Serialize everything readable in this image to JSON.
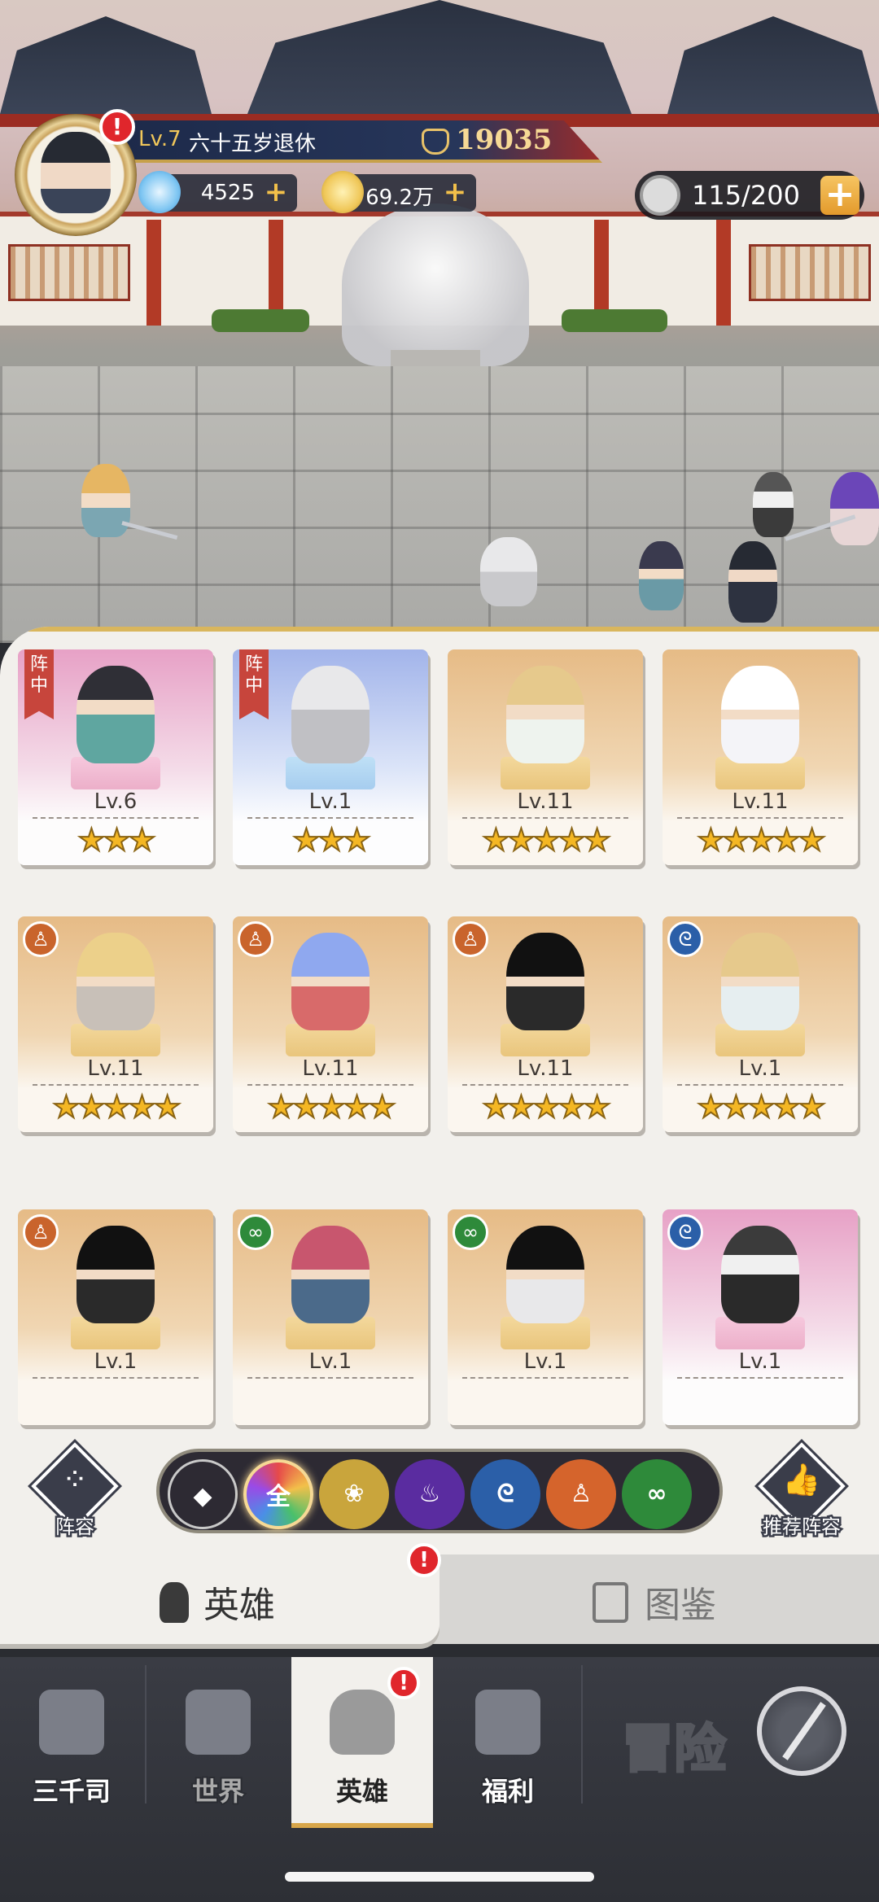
{
  "player": {
    "level_label": "Lv.7",
    "name": "六十五岁退休",
    "power": "19035",
    "alert": "!"
  },
  "resources": {
    "diamonds": "4525",
    "coins": "69.2万",
    "stamina": "115/200",
    "plus": "+"
  },
  "heroes": [
    {
      "level": "Lv.6",
      "stars": "★★★",
      "tag": "阵中",
      "bg": "pink"
    },
    {
      "level": "Lv.1",
      "stars": "★★★",
      "tag": "阵中",
      "bg": "blue"
    },
    {
      "level": "Lv.11",
      "stars": "★★★★★",
      "tag": "",
      "bg": "gold"
    },
    {
      "level": "Lv.11",
      "stars": "★★★★★",
      "tag": "",
      "bg": "gold"
    },
    {
      "level": "Lv.11",
      "stars": "★★★★★",
      "class_icon": "monk-icon",
      "bg": "gold"
    },
    {
      "level": "Lv.11",
      "stars": "★★★★★",
      "class_icon": "monk-icon",
      "bg": "gold"
    },
    {
      "level": "Lv.11",
      "stars": "★★★★★",
      "class_icon": "monk-icon",
      "bg": "gold"
    },
    {
      "level": "Lv.1",
      "stars": "★★★★★",
      "class_icon": "swirl-icon",
      "bg": "gold"
    },
    {
      "level": "Lv.1",
      "stars": "",
      "class_icon": "monk-icon",
      "bg": "gold"
    },
    {
      "level": "Lv.1",
      "stars": "",
      "class_icon": "dna-icon",
      "bg": "gold"
    },
    {
      "level": "Lv.1",
      "stars": "",
      "class_icon": "dna-icon",
      "bg": "gold"
    },
    {
      "level": "Lv.1",
      "stars": "",
      "class_icon": "swirl-icon",
      "bg": "pink"
    }
  ],
  "filters": {
    "all_label": "全",
    "lineup_label": "阵容",
    "recommend_label": "推荐阵容",
    "icons": [
      "diamond-icon",
      "all-icon",
      "lotus-icon",
      "flame-icon",
      "swirl-icon",
      "monk-icon",
      "dna-icon"
    ]
  },
  "subtabs": {
    "hero": "英雄",
    "codex": "图鉴"
  },
  "nav": {
    "sanqiansi": "三千司",
    "world": "世界",
    "hero": "英雄",
    "welfare": "福利",
    "adventure": "冒险"
  },
  "colors": {
    "gold": "#d9b65d",
    "star": "#f4b724",
    "alert": "#e0262c"
  }
}
